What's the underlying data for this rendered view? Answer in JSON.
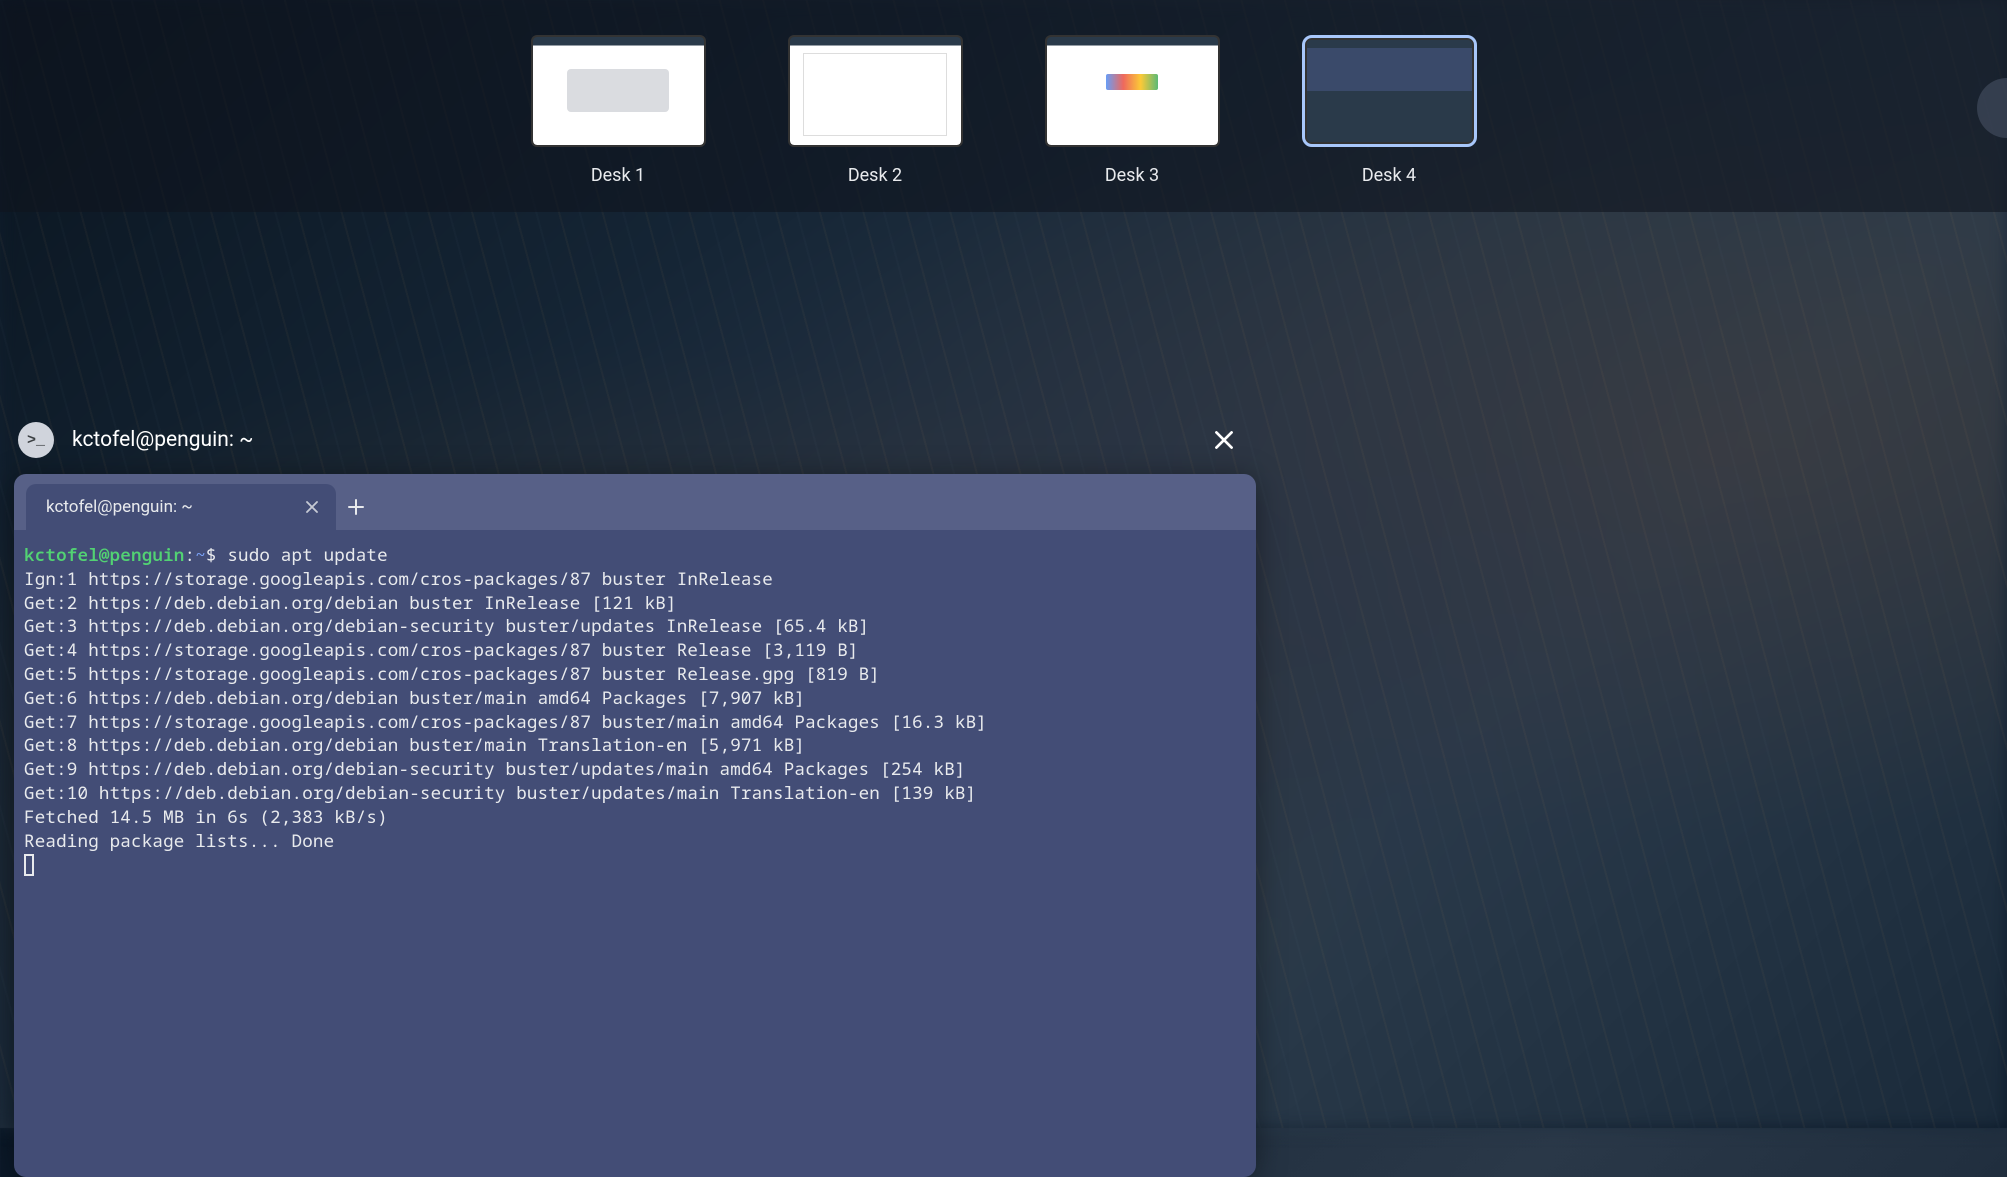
{
  "desks": [
    {
      "label": "Desk 1"
    },
    {
      "label": "Desk 2"
    },
    {
      "label": "Desk 3"
    },
    {
      "label": "Desk 4"
    }
  ],
  "active_desk_index": 3,
  "window": {
    "title": "kctofel@penguin: ~",
    "app_icon_glyph": ">_"
  },
  "terminal": {
    "tab_title": "kctofel@penguin: ~",
    "prompt": {
      "user": "kctofel@penguin",
      "path": "~",
      "sep": ":",
      "symbol": "$"
    },
    "command": "sudo apt update",
    "output_lines": [
      "Ign:1 https://storage.googleapis.com/cros-packages/87 buster InRelease",
      "Get:2 https://deb.debian.org/debian buster InRelease [121 kB]",
      "Get:3 https://deb.debian.org/debian-security buster/updates InRelease [65.4 kB]",
      "Get:4 https://storage.googleapis.com/cros-packages/87 buster Release [3,119 B]",
      "Get:5 https://storage.googleapis.com/cros-packages/87 buster Release.gpg [819 B]",
      "Get:6 https://deb.debian.org/debian buster/main amd64 Packages [7,907 kB]",
      "Get:7 https://storage.googleapis.com/cros-packages/87 buster/main amd64 Packages [16.3 kB]",
      "Get:8 https://deb.debian.org/debian buster/main Translation-en [5,971 kB]",
      "Get:9 https://deb.debian.org/debian-security buster/updates/main amd64 Packages [254 kB]",
      "Get:10 https://deb.debian.org/debian-security buster/updates/main Translation-en [139 kB]",
      "Fetched 14.5 MB in 6s (2,383 kB/s)",
      "Reading package lists... Done"
    ]
  }
}
